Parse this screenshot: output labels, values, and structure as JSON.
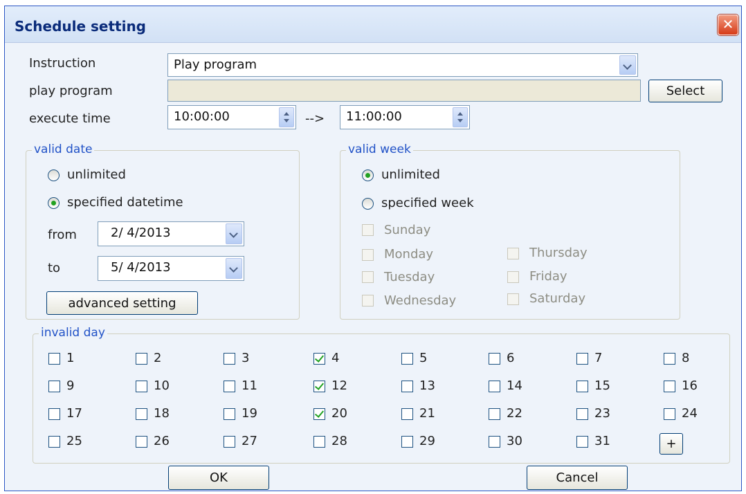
{
  "window": {
    "title": "Schedule setting",
    "close_glyph": "✕"
  },
  "instruction": {
    "label": "Instruction",
    "value": "Play program"
  },
  "play_program": {
    "label": "play program",
    "value": "",
    "select_button": "Select"
  },
  "execute_time": {
    "label": "execute time",
    "start": "10:00:00",
    "arrow": "-->",
    "end": "11:00:00"
  },
  "valid_date": {
    "title": "valid date",
    "unlimited_label": "unlimited",
    "specified_label": "specified datetime",
    "selected": "specified datetime",
    "from_label": "from",
    "from_value": "2/ 4/2013",
    "to_label": "to",
    "to_value": "5/ 4/2013",
    "advanced_button": "advanced setting"
  },
  "valid_week": {
    "title": "valid week",
    "unlimited_label": "unlimited",
    "specified_label": "specified week",
    "selected": "unlimited",
    "days": [
      "Sunday",
      "Monday",
      "Tuesday",
      "Wednesday",
      "Thursday",
      "Friday",
      "Saturday"
    ]
  },
  "invalid_day": {
    "title": "invalid day",
    "days": [
      "1",
      "2",
      "3",
      "4",
      "5",
      "6",
      "7",
      "8",
      "9",
      "10",
      "11",
      "12",
      "13",
      "14",
      "15",
      "16",
      "17",
      "18",
      "19",
      "20",
      "21",
      "22",
      "23",
      "24",
      "25",
      "26",
      "27",
      "28",
      "29",
      "30",
      "31"
    ],
    "checked": [
      "4",
      "12",
      "20"
    ],
    "add_button": "+"
  },
  "footer": {
    "ok": "OK",
    "cancel": "Cancel"
  },
  "colors": {
    "group_title": "#2152c7",
    "check": "#21a121",
    "title_text": "#0a2b7a"
  }
}
